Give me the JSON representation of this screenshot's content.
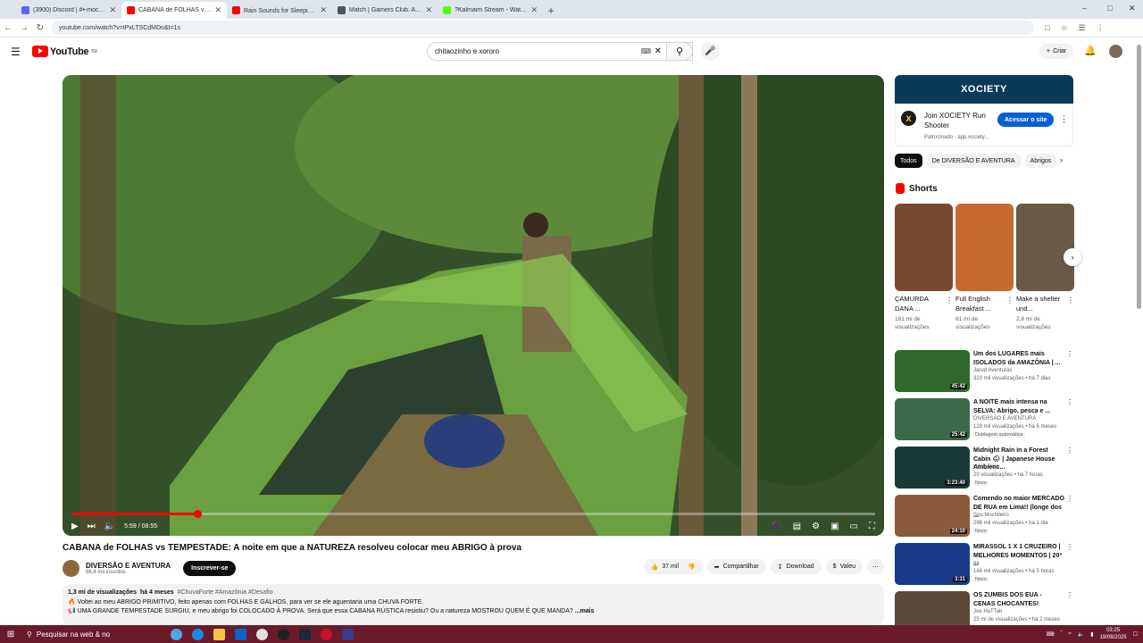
{
  "browser": {
    "tabs": [
      {
        "title": "(3900) Discord | #•-mochilas...",
        "color": "#5865f2",
        "active": false
      },
      {
        "title": "CABANA de FOLHAS vs TEMPESTADE",
        "color": "#ff0000",
        "active": true
      },
      {
        "title": "Rain Sounds for Sleeping 🌧",
        "color": "#ff0000",
        "active": false
      },
      {
        "title": "Match | Gamers Club. Aqui voc...",
        "color": "#4a5562",
        "active": false
      },
      {
        "title": "?Kalmaim Stream - Watch Live",
        "color": "#53fc18",
        "active": false
      }
    ],
    "new_tab": "+",
    "url": "youtube.com/watch?v=tPxLTSCdMDo&t=1s",
    "window_controls": [
      "–",
      "□",
      "✕"
    ]
  },
  "youtube": {
    "logo_text": "YouTube",
    "logo_region": "BR",
    "search_value": "chitaozinho e xororo",
    "create_label": "Criar"
  },
  "player": {
    "time": "5:59 / 08:55",
    "progress_fraction": 0.157
  },
  "video": {
    "title": "CABANA de FOLHAS vs TEMPESTADE: A noite em que a NATUREZA resolveu colocar meu ABRIGO à prova",
    "channel": "DIVERSÃO E AVENTURA",
    "subscribers": "66,4 mil inscritos",
    "subscribe_label": "Inscrever-se",
    "likes": "37 mil",
    "share_label": "Compartilhar",
    "download_label": "Download",
    "thanks_label": "Valeu",
    "description": {
      "views": "1,3 mi de visualizações",
      "age": "há 4 meses",
      "tags": "#ChuvaForte #Amazônia #Desafio",
      "line1": "🔥 Voltei ao meu ABRIGO PRIMITIVO, feito apenas com FOLHAS E GALHOS, para ver se ele aguentaria uma CHUVA FORTE.",
      "line2": "📢 UMA GRANDE TEMPESTADE SURGIU, e meu abrigo foi COLOCADO À PROVA. Será que essa CABANA RÚSTICA resistiu? Ou a natureza MOSTROU QUEM É QUE MANDA?",
      "more": "...mais"
    }
  },
  "ad": {
    "banner": "XOCIETY",
    "logo_letter": "X",
    "title": "Join XOCIETY Run Shooter",
    "sponsor": "Patrocinado · app.xociety...",
    "cta": "Acessar o site"
  },
  "chips": [
    "Todos",
    "De DIVERSÃO E AVENTURA",
    "Abrigos"
  ],
  "shorts": {
    "heading": "Shorts",
    "items": [
      {
        "title": "ÇAMURDA DANA ...",
        "views": "161 mi de visualizações",
        "color": "#7a4a30"
      },
      {
        "title": "Full English Breakfast ...",
        "views": "81 mi de visualizações",
        "color": "#c86a30"
      },
      {
        "title": "Make a shelter und...",
        "views": "2,8 mi de visualizações",
        "color": "#6a5a48"
      }
    ]
  },
  "recommendations": [
    {
      "title": "Um dos LUGARES mais ISOLADOS da AMAZÔNIA | ...",
      "channel": "Jarud Aventuras",
      "views": "323 mil visualizações • há 7 dias",
      "badge": "",
      "duration": "45:42",
      "color": "#2f6a2a"
    },
    {
      "title": "A NOITE mais intensa na SELVA: Abrigo, pesca e ...",
      "channel": "DIVERSÃO E AVENTURA",
      "views": "128 mil visualizações • há 6 meses",
      "badge": "Dublagem automática",
      "duration": "25:42",
      "color": "#3a6a4a"
    },
    {
      "title": "Midnight Rain in a Forest Cabin 🌧 | Japanese House Ambienc...",
      "channel": "Hibiki Rain",
      "views": "20 visualizações • há 7 horas",
      "badge": "Novo",
      "duration": "3:23:40",
      "color": "#1a3a3a"
    },
    {
      "title": "Comendo no maior MERCADO DE RUA em Lima!! (longe dos ...",
      "channel": "Sou Mochileiro",
      "views": "296 mil visualizações • há 1 dia",
      "badge": "Novo",
      "duration": "24:10",
      "color": "#8a5a3a"
    },
    {
      "title": "MIRASSOL 1 X 1 CRUZEIRO | MELHORES MOMENTOS | 20ª ...",
      "channel": "ge",
      "views": "148 mil visualizações • há 5 horas",
      "badge": "Novo",
      "duration": "3:31",
      "color": "#1a3a8a"
    },
    {
      "title": "OS ZUMBIS DOS EUA - CENAS CHOCANTES!",
      "channel": "Joe HaTTab",
      "views": "25 mi de visualizações • há 2 meses",
      "badge": "",
      "duration": "",
      "color": "#5a4a3a"
    }
  ],
  "taskbar": {
    "search_placeholder": "Pesquisar na web & no",
    "time": "03:25",
    "date": "19/08/2025"
  }
}
